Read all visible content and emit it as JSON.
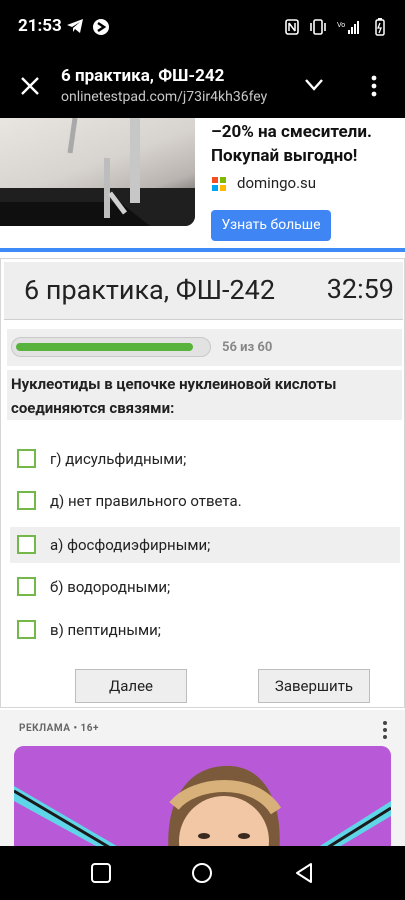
{
  "status_bar": {
    "time": "21:53"
  },
  "toolbar": {
    "title": "6 практика, ФШ-242",
    "url": "onlinetestpad.com/j73ir4kh36fey"
  },
  "ad_top": {
    "headline_1": "–20% на смесители.",
    "headline_2": "Покупай выгодно!",
    "domain": "domingo.su",
    "button_label": "Узнать больше"
  },
  "test": {
    "name": "6 практика, ФШ-242",
    "timer": "32:59",
    "progress_text": "56 из 60",
    "progress_fraction": 0.933,
    "question": "Нуклеотиды в цепочке нуклеиновой кислоты соединяются связями:",
    "options": [
      {
        "label": "г) дисульфидными;"
      },
      {
        "label": "д) нет правильного ответа."
      },
      {
        "label": "а) фосфодиэфирными;"
      },
      {
        "label": "б) водородными;"
      },
      {
        "label": "в) пептидными;"
      }
    ],
    "next_label": "Далее",
    "finish_label": "Завершить"
  },
  "ad_bottom": {
    "label": "РЕКЛАМА • 16+"
  },
  "colors": {
    "progress": "#57b33b",
    "checkbox_border": "#74b84a",
    "ad_button": "#3f86f4",
    "accent_line": "#3e8af6",
    "ad_bg": "#b85ad8"
  },
  "icons": [
    "telegram-icon",
    "circle-app-icon",
    "nfc-icon",
    "vibrate-icon",
    "wifi-signal-icon",
    "battery-icon",
    "close-icon",
    "chevron-down-icon",
    "more-vert-icon",
    "microsoft-logo-icon",
    "recents-nav-icon",
    "home-nav-icon",
    "back-nav-icon"
  ]
}
